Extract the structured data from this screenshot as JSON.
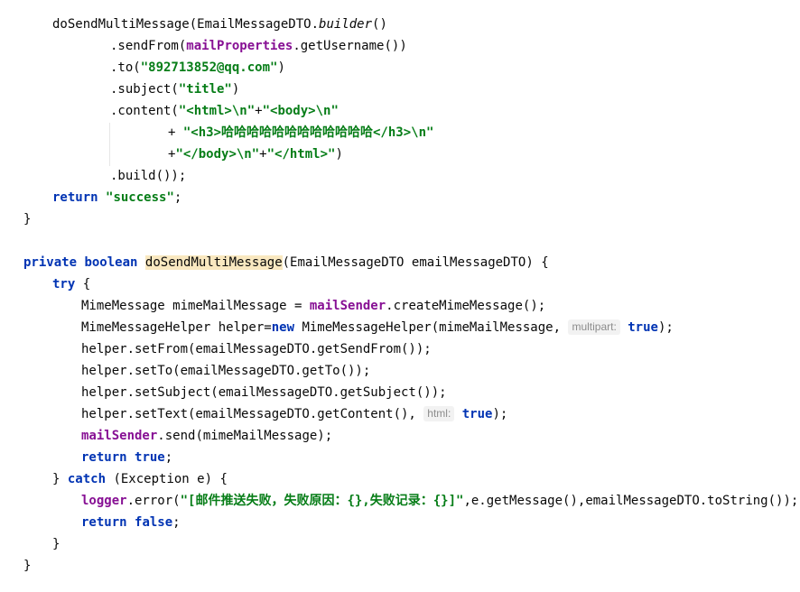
{
  "code": {
    "l1": {
      "a": "doSendMultiMessage(EmailMessageDTO.",
      "b": "builder",
      "c": "()"
    },
    "l2": {
      "a": ".sendFrom(",
      "b": "mailProperties",
      "c": ".getUsername())"
    },
    "l3": {
      "a": ".to(",
      "b": "\"892713852@qq.com\"",
      "c": ")"
    },
    "l4": {
      "a": ".subject(",
      "b": "\"title\"",
      "c": ")"
    },
    "l5": {
      "a": ".content(",
      "b": "\"<html>\\n\"",
      "c": "+",
      "d": "\"<body>\\n\""
    },
    "l6": {
      "a": "+ ",
      "b": "\"<h3>哈哈哈哈哈哈哈哈哈哈哈哈</h3>\\n\""
    },
    "l7": {
      "a": "+",
      "b": "\"</body>\\n\"",
      "c": "+",
      "d": "\"</html>\"",
      "e": ")"
    },
    "l8": {
      "a": ".build());"
    },
    "l9": {
      "kw": "return",
      "b": "\"success\"",
      "c": ";"
    },
    "l10": {
      "a": "}"
    },
    "l12": {
      "kw1": "private",
      "kw2": "boolean",
      "name": "doSendMultiMessage",
      "c": "(EmailMessageDTO emailMessageDTO) {"
    },
    "l13": {
      "kw": "try",
      "c": " {"
    },
    "l14": {
      "a": "MimeMessage mimeMailMessage = ",
      "b": "mailSender",
      "c": ".createMimeMessage();"
    },
    "l15": {
      "a": "MimeMessageHelper helper=",
      "kw": "new",
      "c": " MimeMessageHelper(mimeMailMessage, ",
      "hint": "multipart:",
      "kw2": "true",
      "e": ");"
    },
    "l16": {
      "a": "helper.setFrom(emailMessageDTO.getSendFrom());"
    },
    "l17": {
      "a": "helper.setTo(emailMessageDTO.getTo());"
    },
    "l18": {
      "a": "helper.setSubject(emailMessageDTO.getSubject());"
    },
    "l19": {
      "a": "helper.setText(emailMessageDTO.getContent(), ",
      "hint": "html:",
      "kw": "true",
      "c": ");"
    },
    "l20": {
      "a": "mailSender",
      "b": ".send(mimeMailMessage);"
    },
    "l21": {
      "kw": "return",
      "kw2": "true",
      "c": ";"
    },
    "l22": {
      "a": "} ",
      "kw": "catch",
      "c": " (Exception e) {"
    },
    "l23": {
      "a": "logger",
      "b": ".error(",
      "s": "\"[邮件推送失败，失败原因：{},失败记录：{}]\"",
      "c": ",e.getMessage(),emailMessageDTO.toString());"
    },
    "l24": {
      "kw": "return",
      "kw2": "false",
      "c": ";"
    },
    "l25": {
      "a": "}"
    },
    "l26": {
      "a": "}"
    }
  }
}
